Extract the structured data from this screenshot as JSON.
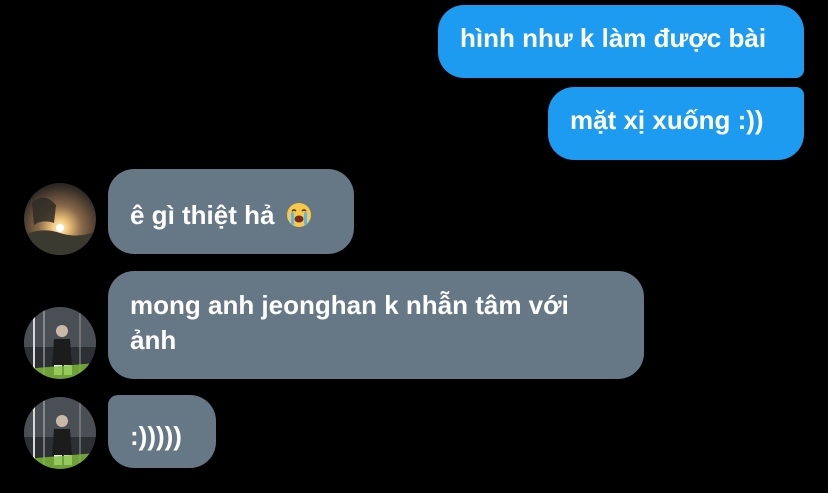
{
  "conversation": {
    "messages": [
      {
        "sender": "me",
        "text": "hình như k làm được bài"
      },
      {
        "sender": "me",
        "text": "mặt xị xuống :))"
      },
      {
        "sender": "other",
        "text": "ê gì thiệt hả",
        "emoji": "loudly-crying-face-emoji"
      },
      {
        "sender": "other",
        "text": "mong anh jeonghan k nhẫn tâm với ảnh"
      },
      {
        "sender": "other",
        "text": ":)))))"
      }
    ],
    "colors": {
      "background": "#000000",
      "outgoing_bubble": "#1d9bf0",
      "incoming_bubble": "#667785",
      "text": "#ffffff"
    }
  }
}
